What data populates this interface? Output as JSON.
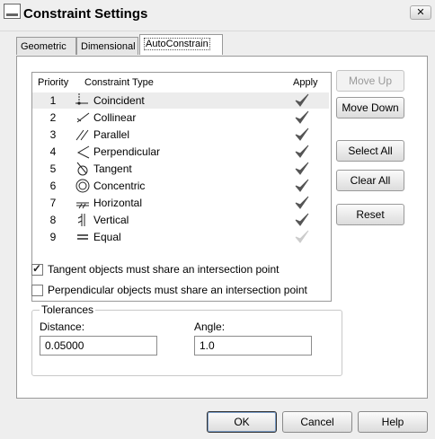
{
  "window": {
    "title": "Constraint Settings",
    "close_label": "✕"
  },
  "tabs": [
    {
      "label": "Geometric"
    },
    {
      "label": "Dimensional"
    },
    {
      "label": "AutoConstrain",
      "active": true
    }
  ],
  "list": {
    "headers": {
      "priority": "Priority",
      "type": "Constraint Type",
      "apply": "Apply"
    },
    "rows": [
      {
        "priority": "1",
        "type": "Coincident",
        "icon": "coincident-icon",
        "apply": true
      },
      {
        "priority": "2",
        "type": "Collinear",
        "icon": "collinear-icon",
        "apply": true
      },
      {
        "priority": "3",
        "type": "Parallel",
        "icon": "parallel-icon",
        "apply": true
      },
      {
        "priority": "4",
        "type": "Perpendicular",
        "icon": "perpendicular-icon",
        "apply": true
      },
      {
        "priority": "5",
        "type": "Tangent",
        "icon": "tangent-icon",
        "apply": true
      },
      {
        "priority": "6",
        "type": "Concentric",
        "icon": "concentric-icon",
        "apply": true
      },
      {
        "priority": "7",
        "type": "Horizontal",
        "icon": "horizontal-icon",
        "apply": true
      },
      {
        "priority": "8",
        "type": "Vertical",
        "icon": "vertical-icon",
        "apply": true
      },
      {
        "priority": "9",
        "type": "Equal",
        "icon": "equal-icon",
        "apply": false
      }
    ]
  },
  "side_buttons": {
    "move_up": "Move Up",
    "move_down": "Move Down",
    "select_all": "Select All",
    "clear_all": "Clear All",
    "reset": "Reset"
  },
  "options": {
    "tangent_label": "Tangent objects must share an intersection point",
    "tangent_checked": true,
    "perpendicular_label": "Perpendicular objects must share an intersection point",
    "perpendicular_checked": false
  },
  "tolerances": {
    "title": "Tolerances",
    "distance_label": "Distance:",
    "distance_value": "0.05000",
    "angle_label": "Angle:",
    "angle_value": "1.0"
  },
  "buttons": {
    "ok": "OK",
    "cancel": "Cancel",
    "help": "Help"
  },
  "colors": {
    "check_dark": "#555555",
    "check_light": "#cccccc",
    "selected_row": "#ececec"
  }
}
